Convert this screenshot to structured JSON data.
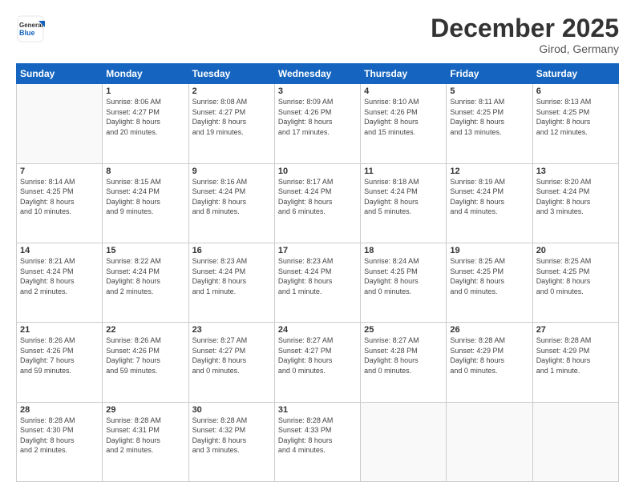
{
  "header": {
    "logo_general": "General",
    "logo_blue": "Blue",
    "month": "December 2025",
    "location": "Girod, Germany"
  },
  "days_header": [
    "Sunday",
    "Monday",
    "Tuesday",
    "Wednesday",
    "Thursday",
    "Friday",
    "Saturday"
  ],
  "weeks": [
    [
      {
        "day": "",
        "info": ""
      },
      {
        "day": "1",
        "info": "Sunrise: 8:06 AM\nSunset: 4:27 PM\nDaylight: 8 hours\nand 20 minutes."
      },
      {
        "day": "2",
        "info": "Sunrise: 8:08 AM\nSunset: 4:27 PM\nDaylight: 8 hours\nand 19 minutes."
      },
      {
        "day": "3",
        "info": "Sunrise: 8:09 AM\nSunset: 4:26 PM\nDaylight: 8 hours\nand 17 minutes."
      },
      {
        "day": "4",
        "info": "Sunrise: 8:10 AM\nSunset: 4:26 PM\nDaylight: 8 hours\nand 15 minutes."
      },
      {
        "day": "5",
        "info": "Sunrise: 8:11 AM\nSunset: 4:25 PM\nDaylight: 8 hours\nand 13 minutes."
      },
      {
        "day": "6",
        "info": "Sunrise: 8:13 AM\nSunset: 4:25 PM\nDaylight: 8 hours\nand 12 minutes."
      }
    ],
    [
      {
        "day": "7",
        "info": "Sunrise: 8:14 AM\nSunset: 4:25 PM\nDaylight: 8 hours\nand 10 minutes."
      },
      {
        "day": "8",
        "info": "Sunrise: 8:15 AM\nSunset: 4:24 PM\nDaylight: 8 hours\nand 9 minutes."
      },
      {
        "day": "9",
        "info": "Sunrise: 8:16 AM\nSunset: 4:24 PM\nDaylight: 8 hours\nand 8 minutes."
      },
      {
        "day": "10",
        "info": "Sunrise: 8:17 AM\nSunset: 4:24 PM\nDaylight: 8 hours\nand 6 minutes."
      },
      {
        "day": "11",
        "info": "Sunrise: 8:18 AM\nSunset: 4:24 PM\nDaylight: 8 hours\nand 5 minutes."
      },
      {
        "day": "12",
        "info": "Sunrise: 8:19 AM\nSunset: 4:24 PM\nDaylight: 8 hours\nand 4 minutes."
      },
      {
        "day": "13",
        "info": "Sunrise: 8:20 AM\nSunset: 4:24 PM\nDaylight: 8 hours\nand 3 minutes."
      }
    ],
    [
      {
        "day": "14",
        "info": "Sunrise: 8:21 AM\nSunset: 4:24 PM\nDaylight: 8 hours\nand 2 minutes."
      },
      {
        "day": "15",
        "info": "Sunrise: 8:22 AM\nSunset: 4:24 PM\nDaylight: 8 hours\nand 2 minutes."
      },
      {
        "day": "16",
        "info": "Sunrise: 8:23 AM\nSunset: 4:24 PM\nDaylight: 8 hours\nand 1 minute."
      },
      {
        "day": "17",
        "info": "Sunrise: 8:23 AM\nSunset: 4:24 PM\nDaylight: 8 hours\nand 1 minute."
      },
      {
        "day": "18",
        "info": "Sunrise: 8:24 AM\nSunset: 4:25 PM\nDaylight: 8 hours\nand 0 minutes."
      },
      {
        "day": "19",
        "info": "Sunrise: 8:25 AM\nSunset: 4:25 PM\nDaylight: 8 hours\nand 0 minutes."
      },
      {
        "day": "20",
        "info": "Sunrise: 8:25 AM\nSunset: 4:25 PM\nDaylight: 8 hours\nand 0 minutes."
      }
    ],
    [
      {
        "day": "21",
        "info": "Sunrise: 8:26 AM\nSunset: 4:26 PM\nDaylight: 7 hours\nand 59 minutes."
      },
      {
        "day": "22",
        "info": "Sunrise: 8:26 AM\nSunset: 4:26 PM\nDaylight: 7 hours\nand 59 minutes."
      },
      {
        "day": "23",
        "info": "Sunrise: 8:27 AM\nSunset: 4:27 PM\nDaylight: 8 hours\nand 0 minutes."
      },
      {
        "day": "24",
        "info": "Sunrise: 8:27 AM\nSunset: 4:27 PM\nDaylight: 8 hours\nand 0 minutes."
      },
      {
        "day": "25",
        "info": "Sunrise: 8:27 AM\nSunset: 4:28 PM\nDaylight: 8 hours\nand 0 minutes."
      },
      {
        "day": "26",
        "info": "Sunrise: 8:28 AM\nSunset: 4:29 PM\nDaylight: 8 hours\nand 0 minutes."
      },
      {
        "day": "27",
        "info": "Sunrise: 8:28 AM\nSunset: 4:29 PM\nDaylight: 8 hours\nand 1 minute."
      }
    ],
    [
      {
        "day": "28",
        "info": "Sunrise: 8:28 AM\nSunset: 4:30 PM\nDaylight: 8 hours\nand 2 minutes."
      },
      {
        "day": "29",
        "info": "Sunrise: 8:28 AM\nSunset: 4:31 PM\nDaylight: 8 hours\nand 2 minutes."
      },
      {
        "day": "30",
        "info": "Sunrise: 8:28 AM\nSunset: 4:32 PM\nDaylight: 8 hours\nand 3 minutes."
      },
      {
        "day": "31",
        "info": "Sunrise: 8:28 AM\nSunset: 4:33 PM\nDaylight: 8 hours\nand 4 minutes."
      },
      {
        "day": "",
        "info": ""
      },
      {
        "day": "",
        "info": ""
      },
      {
        "day": "",
        "info": ""
      }
    ]
  ]
}
